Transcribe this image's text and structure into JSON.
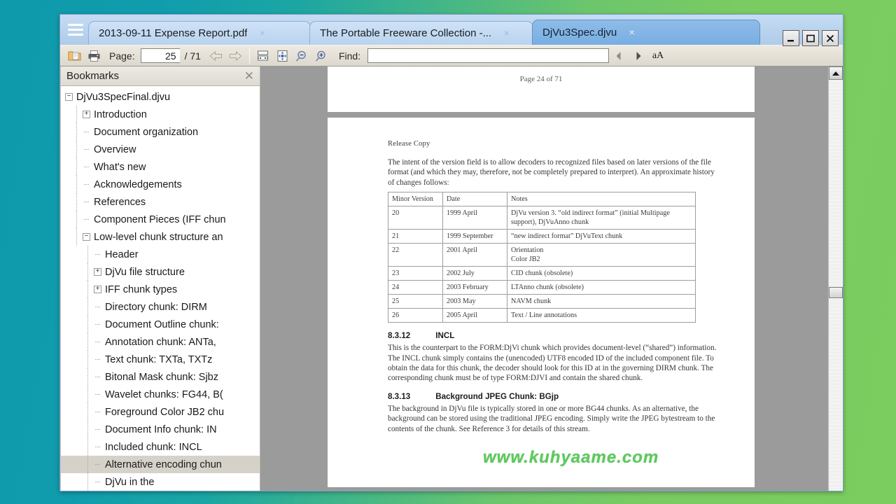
{
  "window": {
    "controls": {
      "minimize": "Minimize",
      "maximize": "Maximize",
      "close": "Close"
    }
  },
  "tabs": [
    {
      "label": "2013-09-11 Expense Report.pdf",
      "close": "×",
      "active": false
    },
    {
      "label": "The  Portable  Freeware  Collection  -...",
      "close": "×",
      "active": false
    },
    {
      "label": "DjVu3Spec.djvu",
      "close": "×",
      "active": true
    }
  ],
  "toolbar": {
    "open_icon": "folder-open-icon",
    "print_icon": "print-icon",
    "page_label": "Page:",
    "page_current": "25",
    "page_total": "/ 71",
    "prev_icon": "arrow-left-icon",
    "next_icon": "arrow-right-icon",
    "fit_width_icon": "fit-width-icon",
    "fit_page_icon": "fit-page-icon",
    "zoom_out_icon": "zoom-out-icon",
    "zoom_in_icon": "zoom-in-icon",
    "find_label": "Find:",
    "find_value": "",
    "find_placeholder": "",
    "find_prev_icon": "find-previous-icon",
    "find_next_icon": "find-next-icon",
    "match_case_label": "aA"
  },
  "bookmarks": {
    "title": "Bookmarks",
    "close": "✕",
    "items": [
      {
        "label": "DjVu3SpecFinal.djvu",
        "depth": 0,
        "toggle": "minus",
        "selected": false
      },
      {
        "label": "Introduction",
        "depth": 1,
        "toggle": "plus",
        "selected": false
      },
      {
        "label": "Document organization",
        "depth": 1,
        "toggle": "none",
        "selected": false
      },
      {
        "label": "Overview",
        "depth": 1,
        "toggle": "none",
        "selected": false
      },
      {
        "label": "What's new",
        "depth": 1,
        "toggle": "none",
        "selected": false
      },
      {
        "label": "Acknowledgements",
        "depth": 1,
        "toggle": "none",
        "selected": false
      },
      {
        "label": "References",
        "depth": 1,
        "toggle": "none",
        "selected": false
      },
      {
        "label": "Component Pieces (IFF chun",
        "depth": 1,
        "toggle": "none",
        "selected": false
      },
      {
        "label": "Low-level chunk structure an",
        "depth": 1,
        "toggle": "minus",
        "selected": false
      },
      {
        "label": "Header",
        "depth": 2,
        "toggle": "none",
        "selected": false
      },
      {
        "label": "DjVu file structure",
        "depth": 2,
        "toggle": "plus",
        "selected": false
      },
      {
        "label": "IFF chunk types",
        "depth": 2,
        "toggle": "plus",
        "selected": false
      },
      {
        "label": "Directory chunk: DIRM",
        "depth": 2,
        "toggle": "none",
        "selected": false
      },
      {
        "label": "Document Outline chunk:",
        "depth": 2,
        "toggle": "none",
        "selected": false
      },
      {
        "label": "Annotation chunk: ANTa,",
        "depth": 2,
        "toggle": "none",
        "selected": false
      },
      {
        "label": "Text chunk: TXTa, TXTz",
        "depth": 2,
        "toggle": "none",
        "selected": false
      },
      {
        "label": "Bitonal Mask chunk: Sjbz",
        "depth": 2,
        "toggle": "none",
        "selected": false
      },
      {
        "label": "Wavelet chunks: FG44, B(",
        "depth": 2,
        "toggle": "none",
        "selected": false
      },
      {
        "label": "Foreground Color JB2 chu",
        "depth": 2,
        "toggle": "none",
        "selected": false
      },
      {
        "label": "Document Info chunk: IN",
        "depth": 2,
        "toggle": "none",
        "selected": false
      },
      {
        "label": "Included chunk: INCL",
        "depth": 2,
        "toggle": "none",
        "selected": false
      },
      {
        "label": "Alternative encoding chun",
        "depth": 2,
        "toggle": "none",
        "selected": true
      },
      {
        "label": "DjVu in the",
        "depth": 2,
        "toggle": "none",
        "selected": false
      }
    ]
  },
  "document": {
    "page_header": "Page 24 of 71",
    "release_note": "Release Copy",
    "intro_paragraph": "The intent of the version field is to allow decoders to recognized files based on later versions of the file format (and which they may, therefore, not be completely prepared to interpret).  An approximate history of changes follows:",
    "version_table": {
      "headers": [
        "Minor Version",
        "Date",
        "Notes"
      ],
      "rows": [
        [
          "20",
          "1999 April",
          "DjVu version 3.  “old indirect format” (initial Multipage support), DjVuAnno chunk"
        ],
        [
          "21",
          "1999 September",
          "“new indirect format” DjVuText chunk"
        ],
        [
          "22",
          "2001 April",
          "Orientation\nColor JB2"
        ],
        [
          "23",
          "2002 July",
          "CID chunk (obsolete)"
        ],
        [
          "24",
          "2003 February",
          "LTAnno chunk (obsolete)"
        ],
        [
          "25",
          "2003 May",
          "NAVM chunk"
        ],
        [
          "26",
          "2005 April",
          "Text / Line annotations"
        ]
      ]
    },
    "sections": [
      {
        "number": "8.3.12",
        "title": "INCL",
        "body": "This is the counterpart to the FORM:DjVi chunk which provides document-level (“shared”) information.  The INCL chunk simply contains the (unencoded) UTF8 encoded ID of the included component file.  To obtain the data for this chunk, the decoder should look for this ID at in the governing DIRM chunk.  The corresponding chunk must be of type FORM:DJVI and contain the shared chunk."
      },
      {
        "number": "8.3.13",
        "title": "Background JPEG Chunk:  BGjp",
        "body": "The background in  DjVu file is typically stored in one or more BG44 chunks.  As an alternative, the background can be stored using the traditional JPEG encoding.  Simply write the JPEG bytestream to the contents of the chunk.  See Reference 3 for details of this stream."
      }
    ],
    "watermark": "www.kuhyaame.com"
  },
  "scrollbar": {
    "up_icon": "scroll-up-arrow-icon",
    "thumb": "scroll-thumb"
  },
  "colors": {
    "tab_active": "#78aee2",
    "tab_inactive": "#c1d8f2",
    "titlebar": "#aecbe9",
    "toolbar": "#e3ded5",
    "watermark_green": "#5ec95e",
    "selection_gray": "#d6d2ca"
  }
}
